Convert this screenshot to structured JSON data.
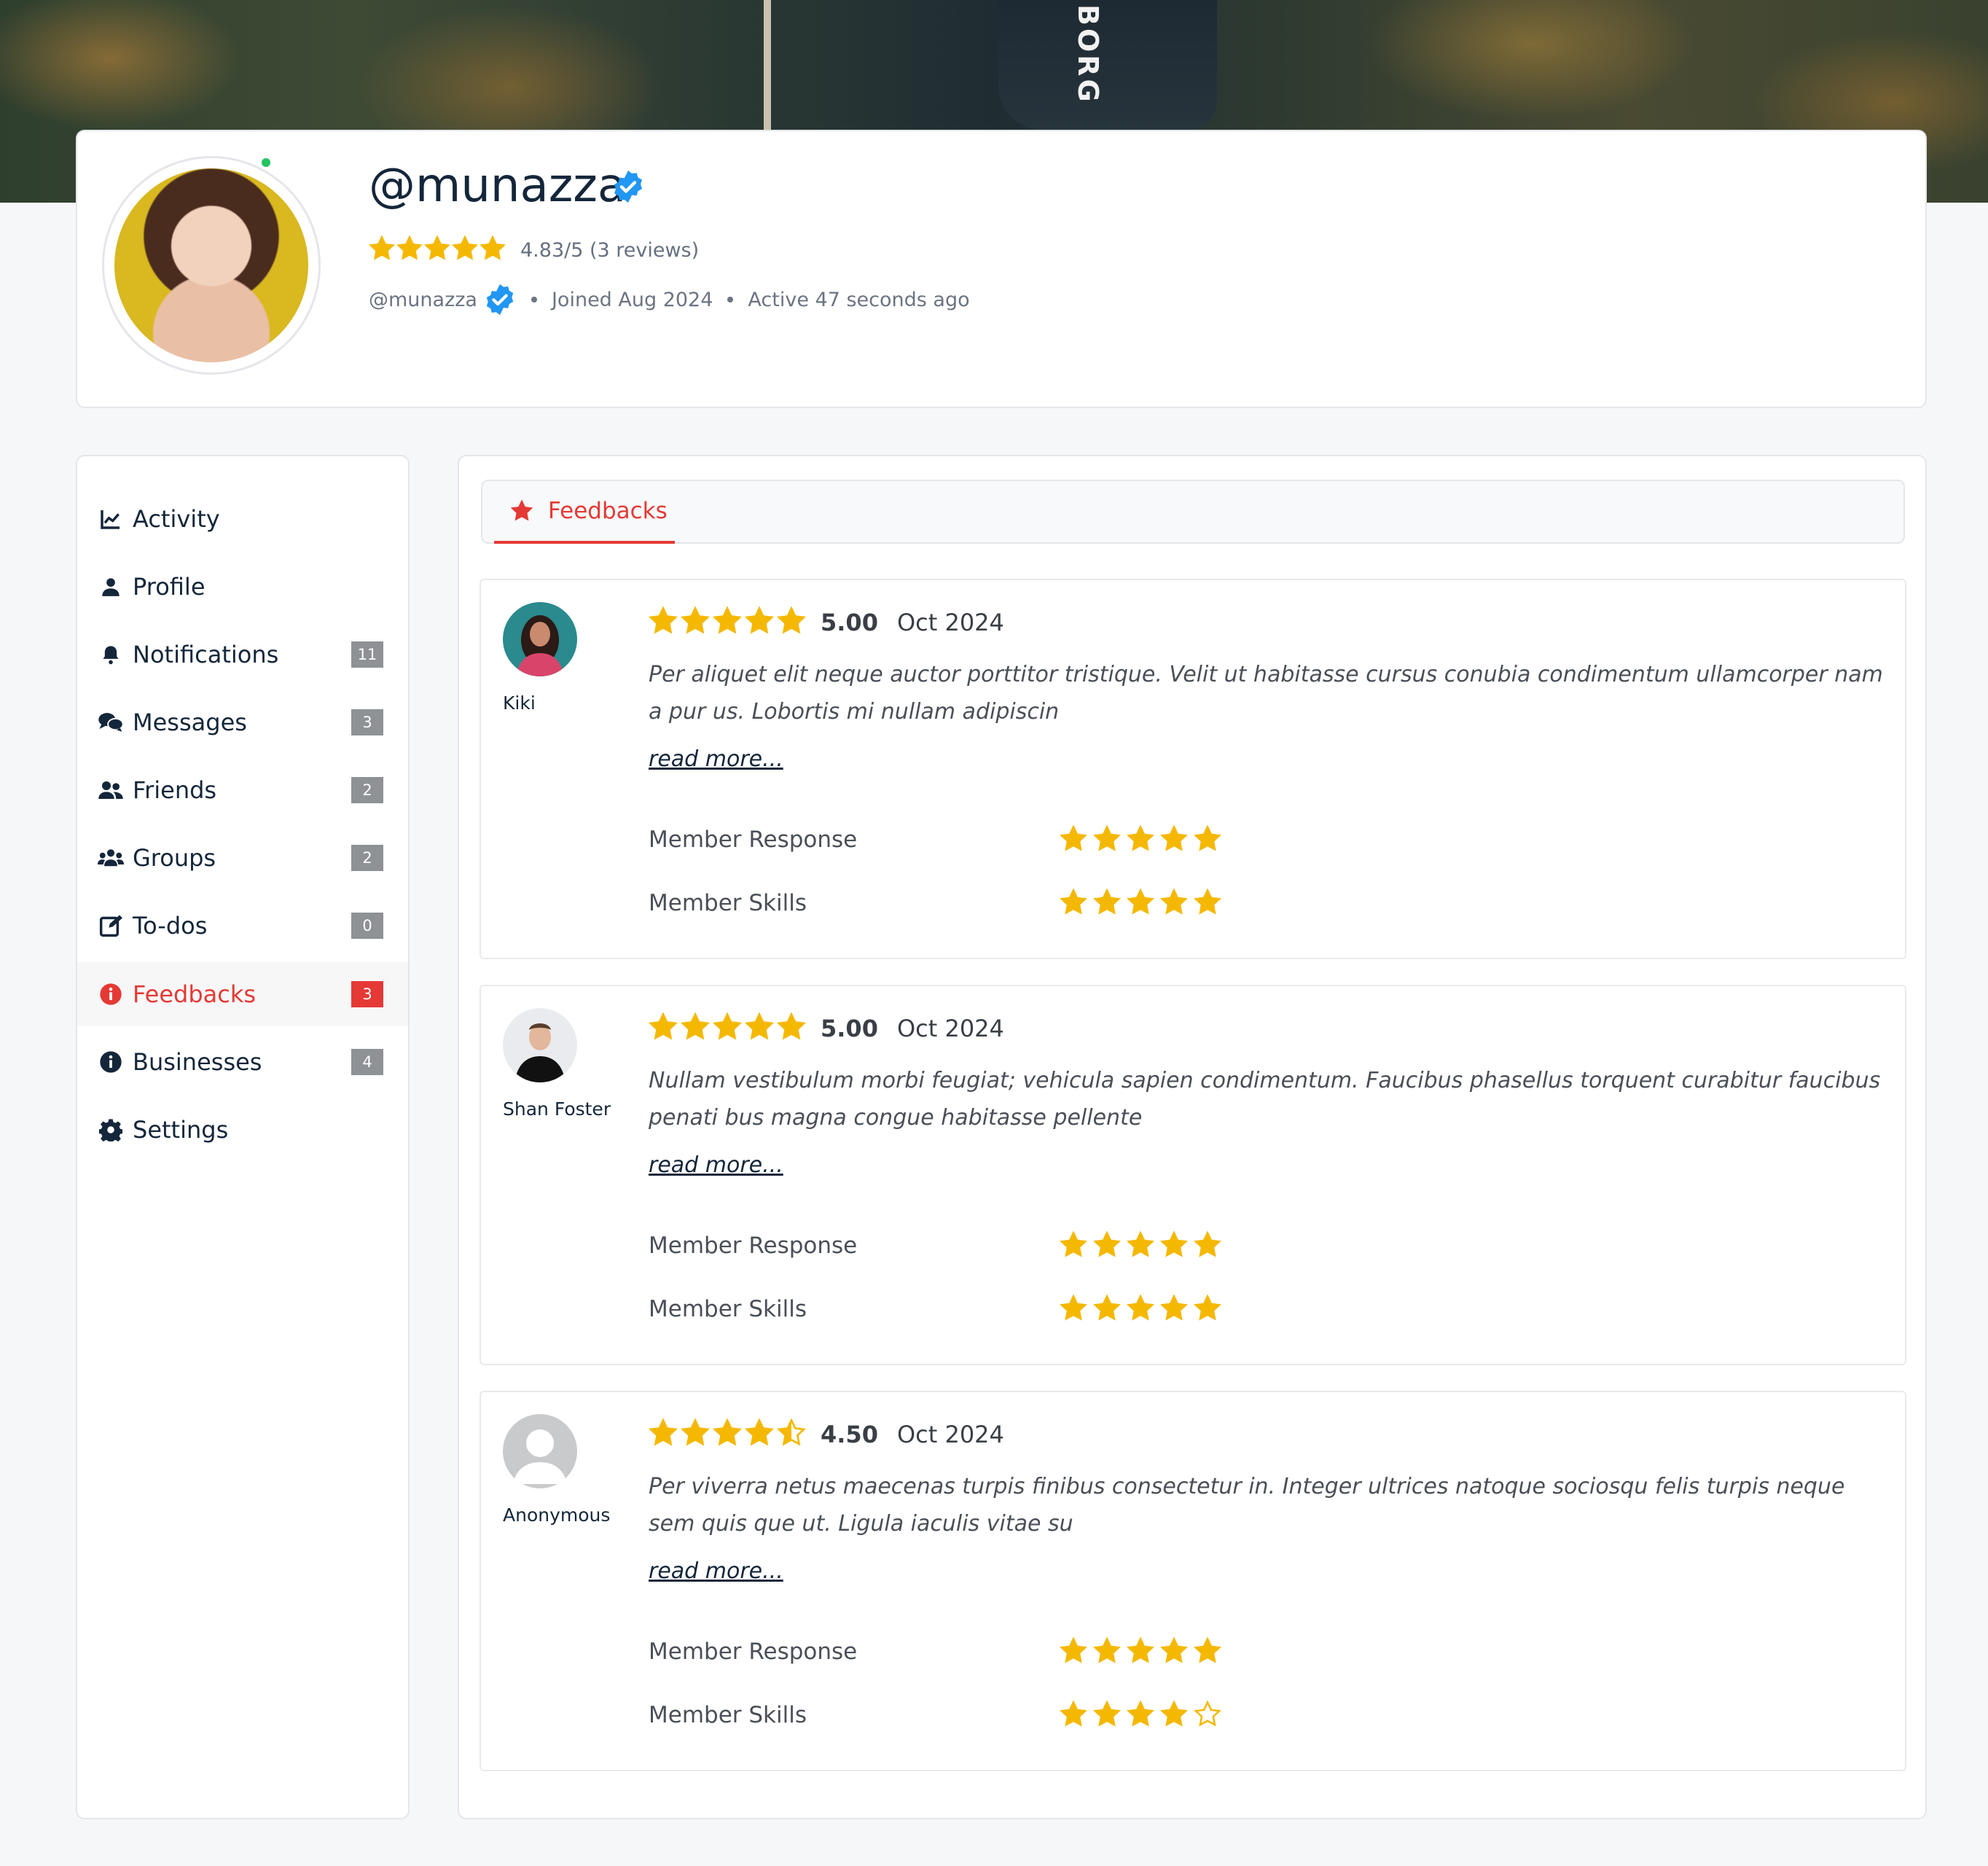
{
  "cover": {
    "text": "BORG"
  },
  "profile": {
    "username": "@munazza",
    "rating_text": "4.83/5 (3 reviews)",
    "rating_value": 4.83,
    "handle": "@munazza",
    "joined": "Joined Aug 2024",
    "active": "Active 47 seconds ago",
    "online": true
  },
  "colors": {
    "accent": "#e53935",
    "star": "#f5b800",
    "badge": "#8e9196",
    "verified": "#2196f3",
    "online": "#22c55e"
  },
  "sidebar": {
    "items": [
      {
        "label": "Activity",
        "icon": "chart-line-icon",
        "badge": ""
      },
      {
        "label": "Profile",
        "icon": "user-icon",
        "badge": ""
      },
      {
        "label": "Notifications",
        "icon": "bell-icon",
        "badge": "11"
      },
      {
        "label": "Messages",
        "icon": "comments-icon",
        "badge": "3"
      },
      {
        "label": "Friends",
        "icon": "user-friends-icon",
        "badge": "2"
      },
      {
        "label": "Groups",
        "icon": "users-icon",
        "badge": "2"
      },
      {
        "label": "To-dos",
        "icon": "edit-icon",
        "badge": "0"
      },
      {
        "label": "Feedbacks",
        "icon": "info-circle-icon",
        "badge": "3",
        "active": true
      },
      {
        "label": "Businesses",
        "icon": "info-circle-icon",
        "badge": "4"
      },
      {
        "label": "Settings",
        "icon": "gear-icon",
        "badge": ""
      }
    ]
  },
  "tabs": [
    {
      "label": "Feedbacks",
      "icon": "star-icon",
      "active": true
    }
  ],
  "reviews": [
    {
      "name": "Kiki",
      "stars": 5,
      "score": "5.00",
      "date": "Oct 2024",
      "text": "Per aliquet elit neque auctor porttitor tristique. Velit ut habitasse cursus conubia condimentum ullamcorper nam a pur us. Lobortis mi nullam adipiscin",
      "read_more": "read more...",
      "criteria": [
        {
          "label": "Member Response",
          "stars": 5
        },
        {
          "label": "Member Skills",
          "stars": 5
        }
      ]
    },
    {
      "name": "Shan Foster",
      "stars": 5,
      "score": "5.00",
      "date": "Oct 2024",
      "text": "Nullam vestibulum morbi feugiat; vehicula sapien condimentum. Faucibus phasellus torquent curabitur faucibus penati bus magna congue habitasse pellente",
      "read_more": "read more...",
      "criteria": [
        {
          "label": "Member Response",
          "stars": 5
        },
        {
          "label": "Member Skills",
          "stars": 5
        }
      ]
    },
    {
      "name": "Anonymous",
      "stars": 4.5,
      "score": "4.50",
      "date": "Oct 2024",
      "text": "Per viverra netus maecenas turpis finibus consectetur in. Integer ultrices natoque sociosqu felis turpis neque sem quis que ut. Ligula iaculis vitae su",
      "read_more": "read more...",
      "criteria": [
        {
          "label": "Member Response",
          "stars": 5
        },
        {
          "label": "Member Skills",
          "stars": 4
        }
      ]
    }
  ]
}
